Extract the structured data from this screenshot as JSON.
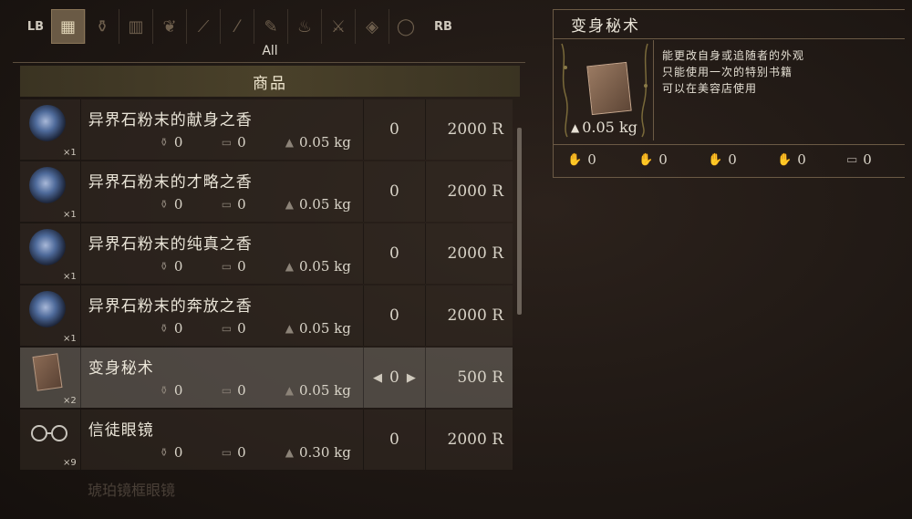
{
  "tabbar": {
    "lb": "LB",
    "rb": "RB",
    "tabs": [
      {
        "icon": "grid-icon",
        "glyph": "▦",
        "active": true
      },
      {
        "icon": "flask-icon",
        "glyph": "⚱",
        "active": false
      },
      {
        "icon": "map-icon",
        "glyph": "▥",
        "active": false
      },
      {
        "icon": "herb-icon",
        "glyph": "❦",
        "active": false
      },
      {
        "icon": "bone-icon",
        "glyph": "⟋",
        "active": false
      },
      {
        "icon": "feather-icon",
        "glyph": "⁄",
        "active": false
      },
      {
        "icon": "scroll-icon",
        "glyph": "✎",
        "active": false
      },
      {
        "icon": "pot-icon",
        "glyph": "♨",
        "active": false
      },
      {
        "icon": "dagger-icon",
        "glyph": "⚔",
        "active": false
      },
      {
        "icon": "gem-icon",
        "glyph": "◈",
        "active": false
      },
      {
        "icon": "ring-icon",
        "glyph": "◯",
        "active": false
      }
    ]
  },
  "filter_label": "All",
  "category": "商品",
  "items": [
    {
      "name": "异界石粉末的献身之香",
      "count": "×1",
      "icon": "orb",
      "stat1": "0",
      "stat2": "0",
      "weight": "0.05 kg",
      "qty": "0",
      "price": "2000 R",
      "selected": false
    },
    {
      "name": "异界石粉末的才略之香",
      "count": "×1",
      "icon": "orb",
      "stat1": "0",
      "stat2": "0",
      "weight": "0.05 kg",
      "qty": "0",
      "price": "2000 R",
      "selected": false
    },
    {
      "name": "异界石粉末的纯真之香",
      "count": "×1",
      "icon": "orb",
      "stat1": "0",
      "stat2": "0",
      "weight": "0.05 kg",
      "qty": "0",
      "price": "2000 R",
      "selected": false
    },
    {
      "name": "异界石粉末的奔放之香",
      "count": "×1",
      "icon": "orb",
      "stat1": "0",
      "stat2": "0",
      "weight": "0.05 kg",
      "qty": "0",
      "price": "2000 R",
      "selected": false
    },
    {
      "name": "变身秘术",
      "count": "×2",
      "icon": "book",
      "stat1": "0",
      "stat2": "0",
      "weight": "0.05 kg",
      "qty": "0",
      "price": "500 R",
      "selected": true
    },
    {
      "name": "信徒眼镜",
      "count": "×9",
      "icon": "glasses",
      "stat1": "0",
      "stat2": "0",
      "weight": "0.30 kg",
      "qty": "0",
      "price": "2000 R",
      "selected": false
    }
  ],
  "faded_next": "琥珀镜框眼镜",
  "detail": {
    "title": "变身秘术",
    "weight": "0.05 kg",
    "description": [
      "能更改自身或追随者的外观",
      "只能使用一次的特别书籍",
      "可以在美容店使用"
    ],
    "requirements": [
      {
        "icon": "red-hand-icon",
        "color": "#c4606a",
        "value": "0"
      },
      {
        "icon": "blue-hand-icon",
        "color": "#5a78c8",
        "value": "0"
      },
      {
        "icon": "gold-hand-icon",
        "color": "#b0924a",
        "value": "0"
      },
      {
        "icon": "orange-hand-icon",
        "color": "#c8904a",
        "value": "0"
      },
      {
        "icon": "chest-icon",
        "color": "#a8a098",
        "value": "0"
      }
    ]
  }
}
